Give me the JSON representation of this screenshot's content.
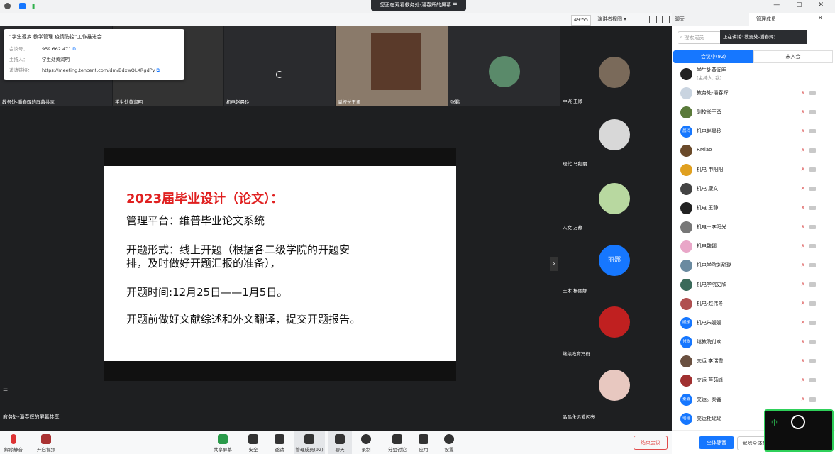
{
  "topbar": {
    "share_banner": "您正在观看教务处-潘春辉的屏幕",
    "banner_icon": "☰",
    "window_controls": "— ▢ ✕"
  },
  "toolbar2": {
    "timer": "49:55",
    "speaker_view": "演讲者视图 ▾",
    "chat_tab": "聊天",
    "manage_tab": "管理成员"
  },
  "info_card": {
    "title": "“学生返乡 教学管理 疫情防控”工作推进会",
    "meeting_id_label": "会议号：",
    "meeting_id": "959 662 471",
    "host_label": "主持人：",
    "host": "学生处黄润明",
    "link_label": "邀请链接：",
    "link": "https://meeting.tencent.com/dm/BdxwQLXRgdPy"
  },
  "top_thumbs": [
    {
      "name": "教务处-潘春辉的屏幕共享"
    },
    {
      "name": "学生处黄润明"
    },
    {
      "name": "机电赵晨玲"
    },
    {
      "name": "副校长王勇"
    },
    {
      "name": "张鹏"
    }
  ],
  "slide": {
    "title": "2023届毕业设计（论文）：",
    "line1": "管理平台：维普毕业论文系统",
    "line2a": "开题形式：线上开题（根据各二级学院的开题安",
    "line2b": "排，及时做好开题汇报的准备），",
    "line3": "开题时间:12月25日——1月5日。",
    "line4": "开题前做好文献综述和外文翻译，提交开题报告。"
  },
  "main_caption": "教务处-潘春辉的屏幕共享",
  "right_tiles": [
    {
      "name": "中兴 王顺"
    },
    {
      "name": "现代 马红丽"
    },
    {
      "name": "人文 万静"
    },
    {
      "name": "土木 杨丽娜",
      "avatar_text": "丽娜"
    },
    {
      "name": "继续教育冯衍"
    },
    {
      "name": "晶晶永远爱闪亮"
    }
  ],
  "bottom_bar": {
    "mute": "解除静音",
    "video": "开启视频",
    "share": "共享屏幕",
    "security": "安全",
    "invite": "邀请",
    "members": "管理成员(92)",
    "chat": "聊天",
    "record": "录制",
    "breakout": "分组讨论",
    "apps": "应用",
    "settings": "设置",
    "end": "结束会议"
  },
  "panel": {
    "search_placeholder": "搜索成员",
    "speaking": "正在讲话: 教务处-潘春辉;",
    "tab_in": "会议中(92)",
    "tab_out": "未入会",
    "members": [
      {
        "name": "学生处黄润明",
        "sub": "(主持人, 我)",
        "color": "#222"
      },
      {
        "name": "教务处-潘春辉",
        "color": "#c9d4e0"
      },
      {
        "name": "副校长王勇",
        "color": "#5a7a3a"
      },
      {
        "name": "机电赵晨玲",
        "avatar_text": "晨玲",
        "color": "#1677ff"
      },
      {
        "name": "RMiao",
        "color": "#6a4a2a"
      },
      {
        "name": "机电 申阳阳",
        "color": "#e0a020"
      },
      {
        "name": "机电 康文",
        "color": "#444"
      },
      {
        "name": "机电 王静",
        "color": "#222"
      },
      {
        "name": "机电－李阳光",
        "color": "#777"
      },
      {
        "name": "机电魏娜",
        "color": "#e9a6c8"
      },
      {
        "name": "机电学院刘甜璐",
        "color": "#6a8aa0"
      },
      {
        "name": "机电学院史欣",
        "color": "#3a6a5a"
      },
      {
        "name": "机电-赵伟冬",
        "color": "#b05050"
      },
      {
        "name": "机电朱媛媛",
        "avatar_text": "媛媛",
        "color": "#1677ff"
      },
      {
        "name": "继教院付欢",
        "avatar_text": "付欢",
        "color": "#1677ff"
      },
      {
        "name": "交运 李瑞霞",
        "color": "#6a5040"
      },
      {
        "name": "交运 芦茹峰",
        "color": "#a03030"
      },
      {
        "name": "交运。秦鑫",
        "avatar_text": "秦鑫",
        "color": "#1677ff"
      },
      {
        "name": "交运杜瑶瑶",
        "avatar_text": "瑶瑶",
        "color": "#1677ff"
      }
    ],
    "mute_all": "全体静音",
    "unmute_all": "解除全体静音"
  },
  "mini_window": {
    "label": "中"
  }
}
